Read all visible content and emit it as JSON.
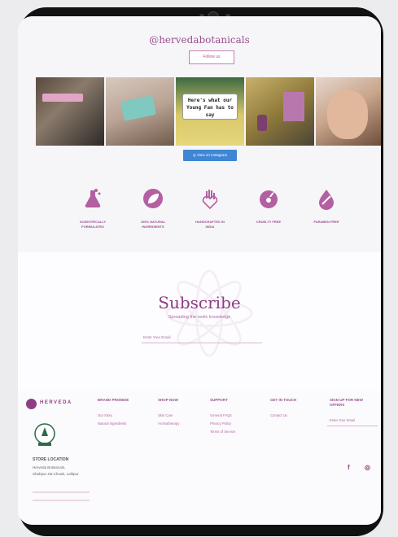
{
  "instagram": {
    "handle": "@hervedabotanicals",
    "follow_label": "Follow us",
    "photo3_sign": "Here's what our Young Fan has to say",
    "view_button": "View on Instagram"
  },
  "features": [
    {
      "label_1": "SCIENTIFICALLY",
      "label_2": "FORMULATED",
      "icon": "flask-icon"
    },
    {
      "label_1": "100% NATURAL",
      "label_2": "INGREDIENTS",
      "icon": "leaf-icon"
    },
    {
      "label_1": "HANDCRAFTED IN",
      "label_2": "INDIA",
      "icon": "hand-heart-icon"
    },
    {
      "label_1": "CRUELTY FREE",
      "label_2": "",
      "icon": "cruelty-free-icon"
    },
    {
      "label_1": "PARABEN FREE",
      "label_2": "",
      "icon": "drop-icon"
    }
  ],
  "subscribe": {
    "title": "Subscribe",
    "tagline": "Spreading the vedic knowledge",
    "email_placeholder": "Enter Your Email"
  },
  "footer": {
    "logo_text": "HERVEDA",
    "columns": [
      {
        "title": "BRAND PROMISE",
        "links": [
          "Our Story",
          "Natural Ingredients"
        ]
      },
      {
        "title": "SHOP NOW",
        "links": [
          "Skin Care",
          "Aromatherapy"
        ]
      },
      {
        "title": "SUPPORT",
        "links": [
          "General FAQs",
          "Privacy Policy",
          "Terms of Service"
        ]
      },
      {
        "title": "GET IN TOUCH",
        "links": [
          "Contact Us"
        ]
      },
      {
        "title": "SIGN UP FOR NEW OFFERS",
        "links": []
      }
    ],
    "signup_placeholder": "Enter Your Email",
    "store_heading": "STORE LOCATION",
    "store_lines": [
      "Herveda Botanicals,",
      "Shahpur Jat Chowk, Lalitpur"
    ],
    "social": [
      "facebook-icon",
      "instagram-icon"
    ],
    "fb_glyph": "f",
    "ig_glyph": "◎"
  },
  "colors": {
    "brand": "#8e3f84",
    "button_blue": "#3f87d4"
  }
}
